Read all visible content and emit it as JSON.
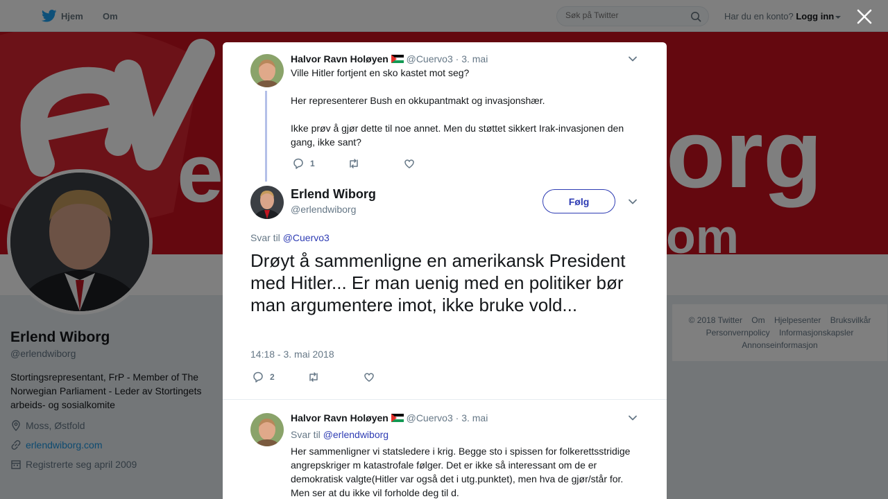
{
  "nav": {
    "home": "Hjem",
    "about": "Om"
  },
  "search": {
    "placeholder": "Søk på Twitter"
  },
  "account": {
    "prompt": "Har du en konto?",
    "login": "Logg inn"
  },
  "banner": {
    "text_left": "ex",
    "text_right": "org",
    "text_bottom": "om"
  },
  "profile": {
    "name": "Erlend Wiborg",
    "handle": "@erlendwiborg",
    "bio": "Stortingsrepresentant, FrP - Member of The Norwegian Parliament - Leder av Stortingets arbeids- og sosialkomite",
    "location": "Moss, Østfold",
    "url": "erlendwiborg.com",
    "joined": "Registrerte seg april 2009"
  },
  "footer": {
    "links": [
      "© 2018 Twitter",
      "Om",
      "Hjelpesenter",
      "Bruksvilkår",
      "Personvernpolicy",
      "Informasjonskapsler",
      "Annonseinformasjon"
    ]
  },
  "modal": {
    "parent": {
      "name": "Halvor Ravn Holøyen",
      "handle": "@Cuervo3",
      "date": "· 3. mai",
      "paragraphs": [
        "Ville Hitler fortjent en sko kastet mot seg?",
        "Her representerer Bush en okkupantmakt og invasjonshær.",
        "Ikke prøv å gjør dette til noe annet. Men du støttet sikkert Irak-invasjonen den gang, ikke sant?"
      ],
      "reply_count": "1"
    },
    "main": {
      "name": "Erlend Wiborg",
      "handle": "@erlendwiborg",
      "follow_label": "Følg",
      "reply_prefix": "Svar til",
      "reply_to": "@Cuervo3",
      "text": "Drøyt å sammenligne en amerikansk President med Hitler... Er man uenig med en politiker bør man argumentere imot, ikke bruke vold...",
      "timestamp": "14:18 - 3. mai 2018",
      "reply_count": "2"
    },
    "reply": {
      "name": "Halvor Ravn Holøyen",
      "handle": "@Cuervo3",
      "date": "· 3. mai",
      "reply_prefix": "Svar til",
      "reply_to": "@erlendwiborg",
      "text": "Her sammenligner vi statsledere i krig. Begge sto i spissen for folkerettsstridige angrepskriger m katastrofale følger. Det er ikke så interessant om de er demokratisk valgte(Hitler var også det i utg.punktet), men hva de gjør/står for. Men ser at du ikke vil forholde deg til d."
    }
  },
  "colors": {
    "accent": "#2d3bb3",
    "banner": "#c8101e",
    "overlay": "rgba(0,0,0,0.5)"
  }
}
